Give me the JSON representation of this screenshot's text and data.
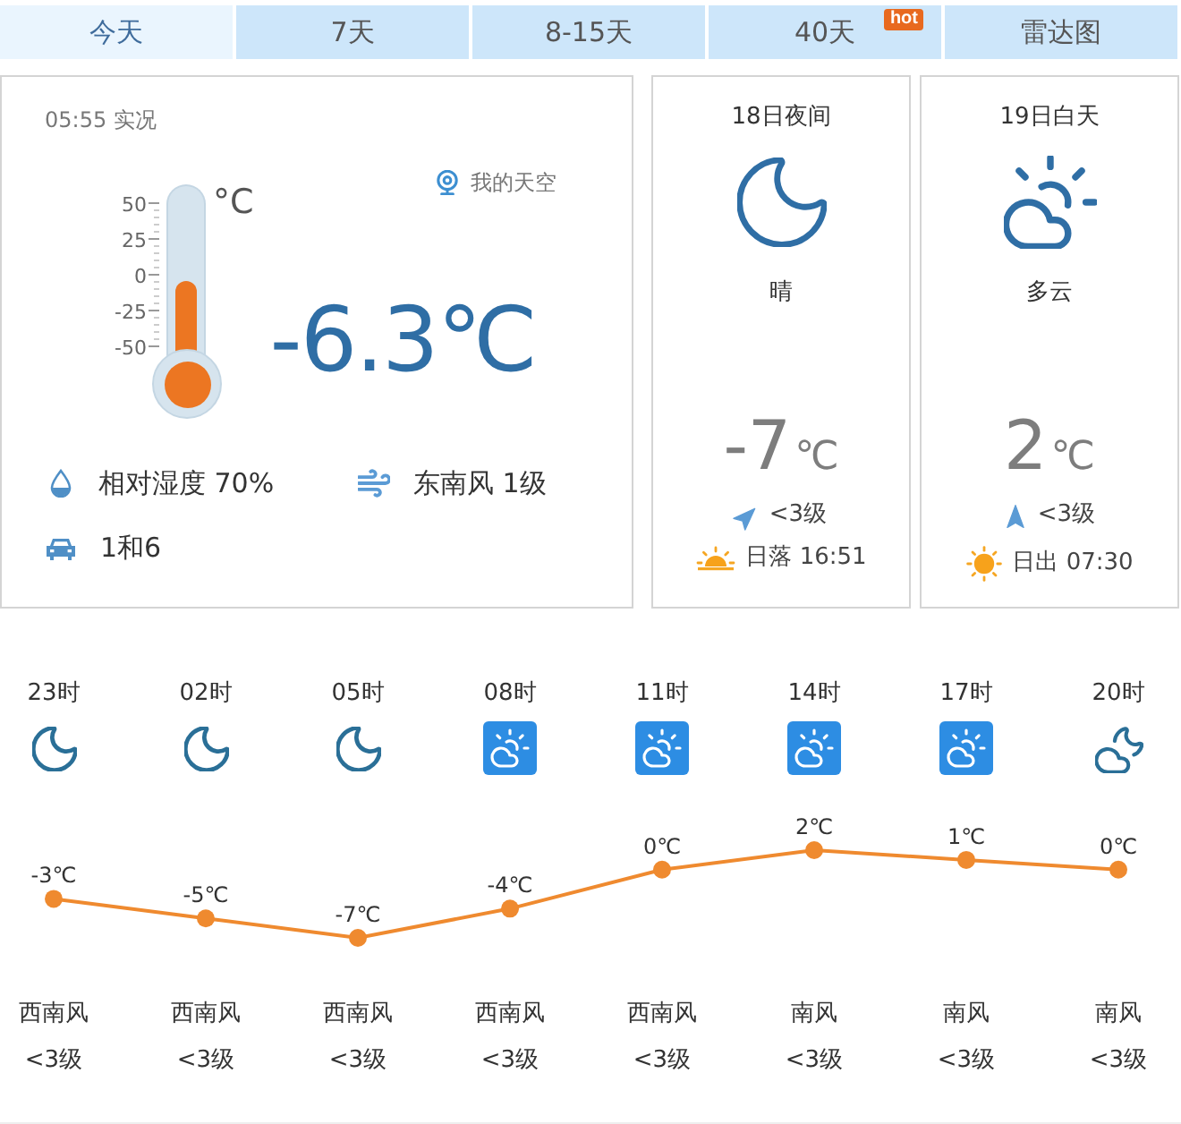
{
  "tabs": [
    {
      "label": "今天",
      "selected": true
    },
    {
      "label": "7天",
      "selected": false
    },
    {
      "label": "8-15天",
      "selected": false
    },
    {
      "label": "40天",
      "selected": false,
      "badge": "hot"
    },
    {
      "label": "雷达图",
      "selected": false
    }
  ],
  "current": {
    "time_label": "05:55 实况",
    "thermometer": {
      "scale": [
        "50",
        "25",
        "0",
        "-25",
        "-50"
      ],
      "unit": "°C",
      "level": 0.52
    },
    "my_sky": "我的天空",
    "temperature": "-6.3℃",
    "humidity": "相对湿度 70%",
    "wind": "东南风 1级",
    "restriction": "1和6"
  },
  "forecast": [
    {
      "title": "18日夜间",
      "kind": "moon",
      "weather": "晴",
      "temp": "-7",
      "unit": "℃",
      "wind": {
        "kind": "ne",
        "text": "<3级"
      },
      "sun": {
        "kind": "set",
        "text": "日落 16:51"
      }
    },
    {
      "title": "19日白天",
      "kind": "cloudsun",
      "weather": "多云",
      "temp": "2",
      "unit": "℃",
      "wind": {
        "kind": "n",
        "text": "<3级"
      },
      "sun": {
        "kind": "rise",
        "text": "日出 07:30"
      }
    }
  ],
  "hourly": {
    "hours": [
      {
        "kind": "moon",
        "wind": "西南风",
        "wind_level": "<3级"
      },
      {
        "kind": "moon",
        "wind": "西南风",
        "wind_level": "<3级"
      },
      {
        "kind": "moon",
        "wind": "西南风",
        "wind_level": "<3级"
      },
      {
        "kind": "cloudsun",
        "wind": "西南风",
        "wind_level": "<3级"
      },
      {
        "kind": "cloudsun",
        "wind": "西南风",
        "wind_level": "<3级"
      },
      {
        "kind": "cloudsun",
        "wind": "南风",
        "wind_level": "<3级"
      },
      {
        "kind": "cloudsun",
        "wind": "南风",
        "wind_level": "<3级"
      },
      {
        "kind": "cloudmoon",
        "wind": "南风",
        "wind_level": "<3级"
      }
    ],
    "chart_data": {
      "type": "line",
      "marker": "circle",
      "categories": [
        "23时",
        "02时",
        "05时",
        "08时",
        "11时",
        "14时",
        "17时",
        "20时"
      ],
      "values": [
        -3,
        -5,
        -7,
        -4,
        0,
        2,
        1,
        0
      ],
      "data_labels": true,
      "value_labels": [
        "-3℃",
        "-5℃",
        "-7℃",
        "-4℃",
        "0℃",
        "2℃",
        "1℃",
        "0℃"
      ]
    }
  }
}
